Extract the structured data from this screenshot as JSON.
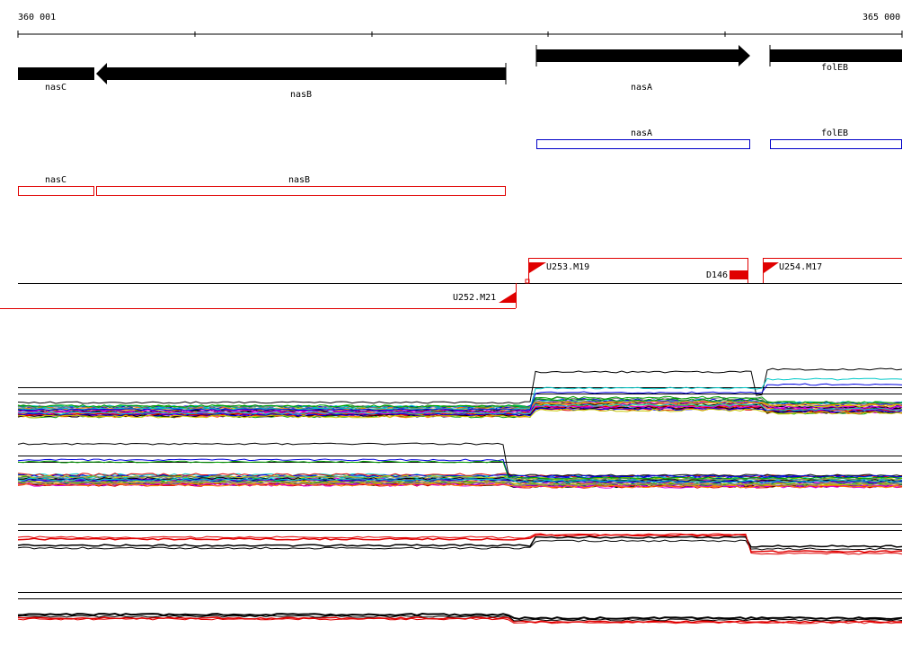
{
  "ruler": {
    "start_label": "360 001",
    "end_label": "365 000"
  },
  "genes_strand": [
    {
      "name": "nasC",
      "direction": "left"
    },
    {
      "name": "nasB",
      "direction": "left"
    },
    {
      "name": "nasA",
      "direction": "right"
    },
    {
      "name": "folEB",
      "direction": "right"
    }
  ],
  "cds_forward": [
    {
      "name": "nasA",
      "color": "#0000c8"
    },
    {
      "name": "folEB",
      "color": "#0000c8"
    }
  ],
  "cds_reverse": [
    {
      "name": "nasC",
      "color": "#e00000"
    },
    {
      "name": "nasB",
      "color": "#e00000"
    }
  ],
  "transcription_units": [
    {
      "name": "U253.M19",
      "color": "#e00000"
    },
    {
      "name": "D146",
      "color": "#e00000"
    },
    {
      "name": "U254.M17",
      "color": "#e00000"
    },
    {
      "name": "U252.M21",
      "color": "#e00000"
    }
  ],
  "expression_tracks": {
    "palette": [
      "#000000",
      "#e00000",
      "#00a000",
      "#0000e0",
      "#e000e0",
      "#00c8c8",
      "#c8c800",
      "#ff8000",
      "#808080",
      "#8000c0"
    ]
  }
}
